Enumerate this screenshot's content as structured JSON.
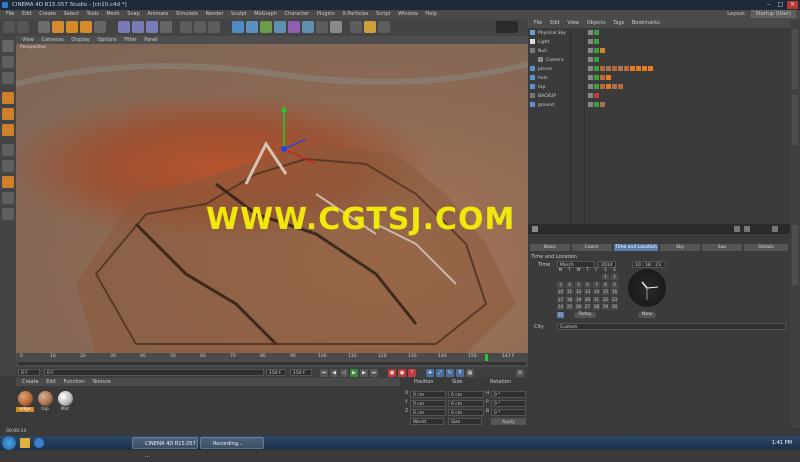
{
  "window": {
    "title": "CINEMA 4D R15.057 Studio - [ch10.c4d *]",
    "layout_label": "Layout:",
    "layout_value": "Startup (User)"
  },
  "menu": [
    "File",
    "Edit",
    "Create",
    "Select",
    "Tools",
    "Mesh",
    "Snap",
    "Animate",
    "Simulate",
    "Render",
    "Sculpt",
    "MoGraph",
    "Character",
    "Plugins",
    "X-Particles",
    "Script",
    "Window",
    "Help"
  ],
  "viewport": {
    "menu": [
      "View",
      "Cameras",
      "Display",
      "Options",
      "Filter",
      "Panel"
    ],
    "label": "Perspective",
    "watermark": "WWW.CGTSJ.COM"
  },
  "timeline": {
    "ticks": [
      "0",
      "10",
      "20",
      "30",
      "40",
      "50",
      "60",
      "70",
      "80",
      "90",
      "100",
      "110",
      "120",
      "130",
      "140",
      "150"
    ],
    "end_frame": "147 F",
    "start_field": "0 F",
    "cur_field": "0 F",
    "max1": "150 F",
    "max2": "150 F"
  },
  "materials": {
    "menu": [
      "Create",
      "Edit",
      "Function",
      "Texture"
    ],
    "items": [
      {
        "label": "edge",
        "color": "#b86a3a"
      },
      {
        "label": "top",
        "color": "#a87554"
      },
      {
        "label": "Mat",
        "color": "#bbbbbb"
      }
    ]
  },
  "coords": {
    "headers": [
      "Position",
      "Size",
      "Rotation"
    ],
    "rows": [
      {
        "axis": "X",
        "pos": "0 cm",
        "size": "0 cm",
        "rot_lbl": "H",
        "rot": "0 °"
      },
      {
        "axis": "Y",
        "pos": "0 cm",
        "size": "0 cm",
        "rot_lbl": "P",
        "rot": "0 °"
      },
      {
        "axis": "Z",
        "pos": "0 cm",
        "size": "0 cm",
        "rot_lbl": "B",
        "rot": "0 °"
      }
    ],
    "world": "World",
    "size_mode": "Size",
    "apply": "Apply"
  },
  "objects": {
    "menu": [
      "File",
      "Edit",
      "View",
      "Objects",
      "Tags",
      "Bookmarks"
    ],
    "items": [
      "Physical Sky",
      "Light",
      "Null",
      "Camera",
      "pieces",
      "hole",
      "top",
      "BACKUP",
      "ground"
    ]
  },
  "attributes": {
    "tabs": [
      "Basic",
      "Coord.",
      "Time and Location",
      "Sky",
      "Sun",
      "Details"
    ],
    "section": "Time and Location",
    "time_label": "Time",
    "month": "March",
    "year": "2014",
    "time_value": "10 : 18 : 23",
    "weekdays": [
      "M",
      "T",
      "W",
      "T",
      "F",
      "S",
      "S"
    ],
    "days": [
      "",
      "",
      "",
      "",
      "",
      "1",
      "2",
      "3",
      "4",
      "5",
      "6",
      "7",
      "8",
      "9",
      "10",
      "11",
      "12",
      "13",
      "14",
      "15",
      "16",
      "17",
      "18",
      "19",
      "20",
      "21",
      "22",
      "23",
      "24",
      "25",
      "26",
      "27",
      "28",
      "29",
      "30",
      "31"
    ],
    "today": "Today",
    "now": "Now",
    "city_label": "City",
    "city_value": "Custom"
  },
  "status": {
    "time": "00:00:14"
  },
  "taskbar": {
    "apps": [
      "CINEMA 4D R15.057 ...",
      "Recording..."
    ],
    "clock": "1:41 PM"
  },
  "colors": {
    "accent": "#5b7fa8",
    "watermark": "#f0e80a",
    "orange_tag": "#e87a20"
  }
}
